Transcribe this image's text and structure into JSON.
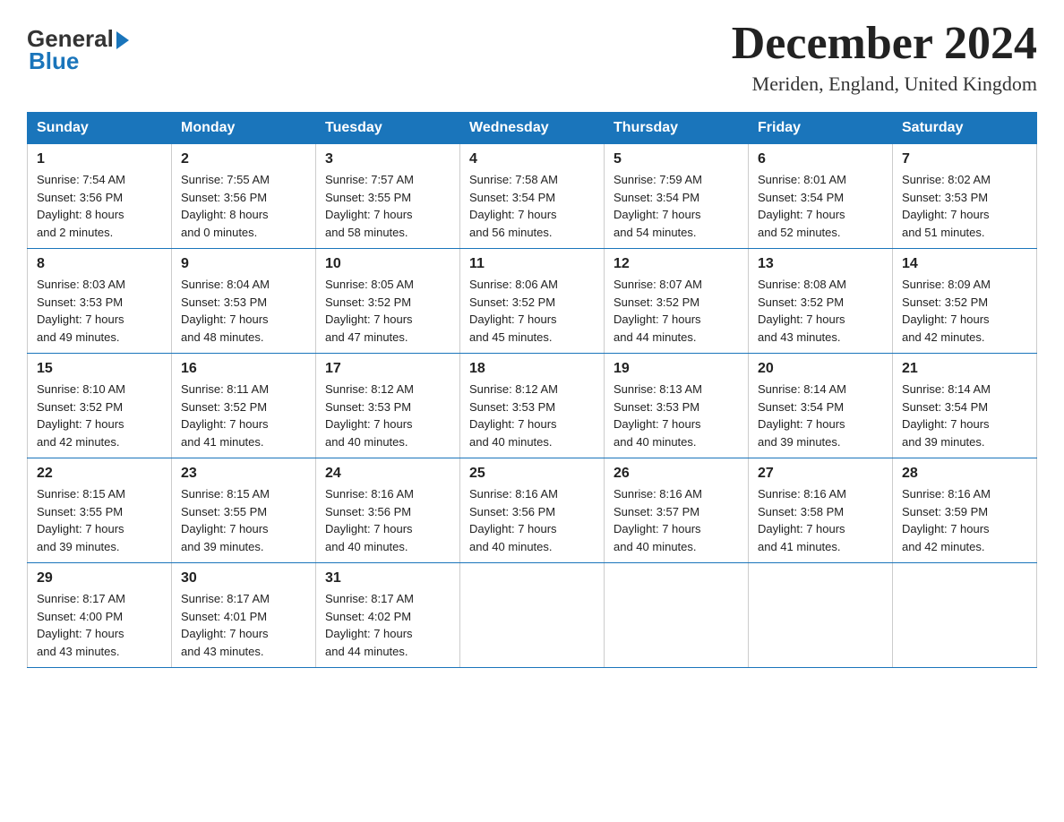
{
  "logo": {
    "general": "General",
    "blue": "Blue"
  },
  "title": "December 2024",
  "subtitle": "Meriden, England, United Kingdom",
  "days_of_week": [
    "Sunday",
    "Monday",
    "Tuesday",
    "Wednesday",
    "Thursday",
    "Friday",
    "Saturday"
  ],
  "weeks": [
    [
      {
        "day": "1",
        "sunrise": "7:54 AM",
        "sunset": "3:56 PM",
        "daylight": "8 hours and 2 minutes."
      },
      {
        "day": "2",
        "sunrise": "7:55 AM",
        "sunset": "3:56 PM",
        "daylight": "8 hours and 0 minutes."
      },
      {
        "day": "3",
        "sunrise": "7:57 AM",
        "sunset": "3:55 PM",
        "daylight": "7 hours and 58 minutes."
      },
      {
        "day": "4",
        "sunrise": "7:58 AM",
        "sunset": "3:54 PM",
        "daylight": "7 hours and 56 minutes."
      },
      {
        "day": "5",
        "sunrise": "7:59 AM",
        "sunset": "3:54 PM",
        "daylight": "7 hours and 54 minutes."
      },
      {
        "day": "6",
        "sunrise": "8:01 AM",
        "sunset": "3:54 PM",
        "daylight": "7 hours and 52 minutes."
      },
      {
        "day": "7",
        "sunrise": "8:02 AM",
        "sunset": "3:53 PM",
        "daylight": "7 hours and 51 minutes."
      }
    ],
    [
      {
        "day": "8",
        "sunrise": "8:03 AM",
        "sunset": "3:53 PM",
        "daylight": "7 hours and 49 minutes."
      },
      {
        "day": "9",
        "sunrise": "8:04 AM",
        "sunset": "3:53 PM",
        "daylight": "7 hours and 48 minutes."
      },
      {
        "day": "10",
        "sunrise": "8:05 AM",
        "sunset": "3:52 PM",
        "daylight": "7 hours and 47 minutes."
      },
      {
        "day": "11",
        "sunrise": "8:06 AM",
        "sunset": "3:52 PM",
        "daylight": "7 hours and 45 minutes."
      },
      {
        "day": "12",
        "sunrise": "8:07 AM",
        "sunset": "3:52 PM",
        "daylight": "7 hours and 44 minutes."
      },
      {
        "day": "13",
        "sunrise": "8:08 AM",
        "sunset": "3:52 PM",
        "daylight": "7 hours and 43 minutes."
      },
      {
        "day": "14",
        "sunrise": "8:09 AM",
        "sunset": "3:52 PM",
        "daylight": "7 hours and 42 minutes."
      }
    ],
    [
      {
        "day": "15",
        "sunrise": "8:10 AM",
        "sunset": "3:52 PM",
        "daylight": "7 hours and 42 minutes."
      },
      {
        "day": "16",
        "sunrise": "8:11 AM",
        "sunset": "3:52 PM",
        "daylight": "7 hours and 41 minutes."
      },
      {
        "day": "17",
        "sunrise": "8:12 AM",
        "sunset": "3:53 PM",
        "daylight": "7 hours and 40 minutes."
      },
      {
        "day": "18",
        "sunrise": "8:12 AM",
        "sunset": "3:53 PM",
        "daylight": "7 hours and 40 minutes."
      },
      {
        "day": "19",
        "sunrise": "8:13 AM",
        "sunset": "3:53 PM",
        "daylight": "7 hours and 40 minutes."
      },
      {
        "day": "20",
        "sunrise": "8:14 AM",
        "sunset": "3:54 PM",
        "daylight": "7 hours and 39 minutes."
      },
      {
        "day": "21",
        "sunrise": "8:14 AM",
        "sunset": "3:54 PM",
        "daylight": "7 hours and 39 minutes."
      }
    ],
    [
      {
        "day": "22",
        "sunrise": "8:15 AM",
        "sunset": "3:55 PM",
        "daylight": "7 hours and 39 minutes."
      },
      {
        "day": "23",
        "sunrise": "8:15 AM",
        "sunset": "3:55 PM",
        "daylight": "7 hours and 39 minutes."
      },
      {
        "day": "24",
        "sunrise": "8:16 AM",
        "sunset": "3:56 PM",
        "daylight": "7 hours and 40 minutes."
      },
      {
        "day": "25",
        "sunrise": "8:16 AM",
        "sunset": "3:56 PM",
        "daylight": "7 hours and 40 minutes."
      },
      {
        "day": "26",
        "sunrise": "8:16 AM",
        "sunset": "3:57 PM",
        "daylight": "7 hours and 40 minutes."
      },
      {
        "day": "27",
        "sunrise": "8:16 AM",
        "sunset": "3:58 PM",
        "daylight": "7 hours and 41 minutes."
      },
      {
        "day": "28",
        "sunrise": "8:16 AM",
        "sunset": "3:59 PM",
        "daylight": "7 hours and 42 minutes."
      }
    ],
    [
      {
        "day": "29",
        "sunrise": "8:17 AM",
        "sunset": "4:00 PM",
        "daylight": "7 hours and 43 minutes."
      },
      {
        "day": "30",
        "sunrise": "8:17 AM",
        "sunset": "4:01 PM",
        "daylight": "7 hours and 43 minutes."
      },
      {
        "day": "31",
        "sunrise": "8:17 AM",
        "sunset": "4:02 PM",
        "daylight": "7 hours and 44 minutes."
      },
      null,
      null,
      null,
      null
    ]
  ]
}
